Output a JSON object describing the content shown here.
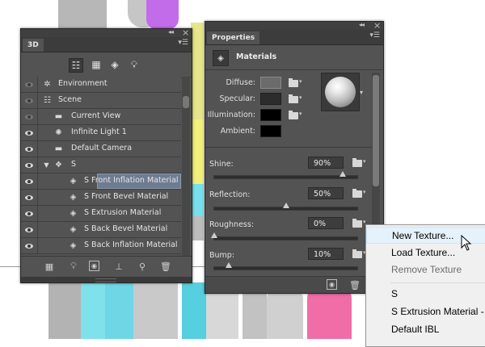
{
  "panel3d": {
    "tab": "3D",
    "tools": [
      "scene-filter-icon",
      "mesh-filter-icon",
      "material-filter-icon",
      "light-filter-icon"
    ],
    "rows": [
      {
        "label": "Environment",
        "icon": "environment-icon",
        "visible": false
      },
      {
        "label": "Scene",
        "icon": "scene-icon",
        "visible": false
      },
      {
        "label": "Current View",
        "icon": "camera-icon",
        "visible": false
      },
      {
        "label": "Infinite Light 1",
        "icon": "light-icon",
        "visible": true
      },
      {
        "label": "Default Camera",
        "icon": "camera-icon",
        "visible": true
      },
      {
        "label": "S",
        "icon": "mesh-icon",
        "visible": true,
        "expanded": true
      },
      {
        "label": "S Front Inflation Material",
        "icon": "material-icon",
        "visible": true,
        "selected": true
      },
      {
        "label": "S Front Bevel Material",
        "icon": "material-icon",
        "visible": true
      },
      {
        "label": "S Extrusion Material",
        "icon": "material-icon",
        "visible": true
      },
      {
        "label": "S Back Bevel Material",
        "icon": "material-icon",
        "visible": true
      },
      {
        "label": "S Back Inflation Material",
        "icon": "material-icon",
        "visible": true
      }
    ]
  },
  "properties": {
    "tab": "Properties",
    "section": "Materials",
    "colors": {
      "diffuse": "#6b6b6b",
      "specular": "#2c2c2c",
      "illumination": "#000000",
      "ambient": "#000000"
    },
    "labels": {
      "diffuse": "Diffuse:",
      "specular": "Specular:",
      "illumination": "Illumination:",
      "ambient": "Ambient:"
    },
    "sliders": [
      {
        "label": "Shine:",
        "value": "90%",
        "fraction": 0.9
      },
      {
        "label": "Reflection:",
        "value": "50%",
        "fraction": 0.5
      },
      {
        "label": "Roughness:",
        "value": "0%",
        "fraction": 0.0
      },
      {
        "label": "Bump:",
        "value": "10%",
        "fraction": 0.1
      }
    ]
  },
  "context_menu": {
    "items": [
      {
        "label": "New Texture...",
        "state": "hover"
      },
      {
        "label": "Load Texture...",
        "state": "normal"
      },
      {
        "label": "Remove Texture",
        "state": "disabled"
      },
      {
        "label": "S",
        "state": "normal"
      },
      {
        "label": "S Extrusion Material - I",
        "state": "normal"
      },
      {
        "label": "Default IBL",
        "state": "normal"
      }
    ]
  }
}
